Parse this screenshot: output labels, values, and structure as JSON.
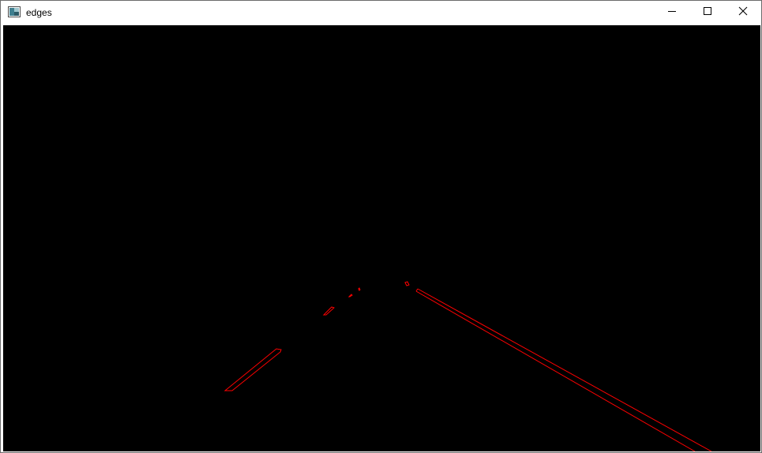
{
  "window": {
    "title": "edges"
  },
  "controls": {
    "minimize": "minimize",
    "maximize": "maximize",
    "close": "close"
  },
  "icons": {
    "app": "image-window-icon",
    "minimize": "minimize-icon",
    "maximize": "maximize-icon",
    "close": "close-icon"
  },
  "colors": {
    "canvas_background": "#000000",
    "edge_stroke": "#ff0000"
  }
}
